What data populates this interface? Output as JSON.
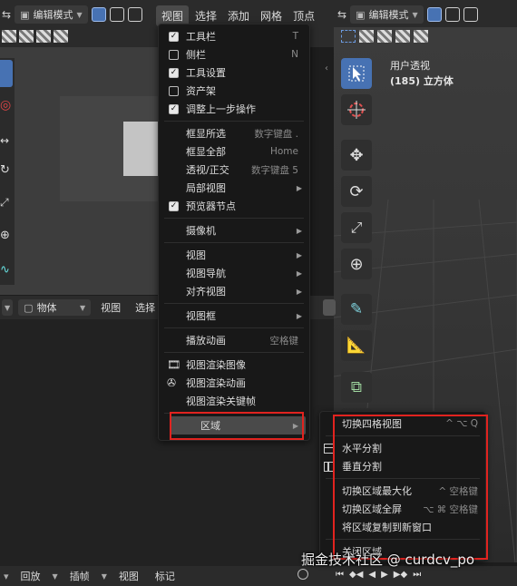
{
  "left_header": {
    "mode": "编辑模式",
    "menus": [
      "视图",
      "选择",
      "添加",
      "网格",
      "顶点"
    ],
    "active_menu": "视图"
  },
  "right_header": {
    "mode": "编辑模式"
  },
  "right_viewport": {
    "view_label": "用户透视",
    "object_label": "(185) 立方体"
  },
  "bottom_left_header": {
    "mode": "物体",
    "menus": [
      "视图",
      "选择"
    ]
  },
  "timeline_header": {
    "menus": [
      "回放",
      "插帧",
      "视图",
      "标记"
    ]
  },
  "view_menu": {
    "items": [
      {
        "label": "工具栏",
        "shortcut": "T",
        "check": "on"
      },
      {
        "label": "侧栏",
        "shortcut": "N",
        "check": "off"
      },
      {
        "label": "工具设置",
        "shortcut": "",
        "check": "on"
      },
      {
        "label": "资产架",
        "shortcut": "",
        "check": "off"
      },
      {
        "label": "调整上一步操作",
        "shortcut": "",
        "check": "on"
      },
      {
        "label": "框显所选",
        "shortcut": "数字键盘 ."
      },
      {
        "label": "框显全部",
        "shortcut": "Home"
      },
      {
        "label": "透视/正交",
        "shortcut": "数字键盘 5"
      },
      {
        "label": "局部视图",
        "submenu": true
      },
      {
        "label": "预览器节点",
        "check": "on"
      },
      {
        "label": "摄像机",
        "submenu": true
      },
      {
        "label": "视图",
        "submenu": true
      },
      {
        "label": "视图导航",
        "submenu": true
      },
      {
        "label": "对齐视图",
        "submenu": true
      },
      {
        "label": "视图框",
        "submenu": true
      },
      {
        "label": "播放动画",
        "shortcut": "空格键"
      },
      {
        "label": "视图渲染图像",
        "icon": "render-image-icon"
      },
      {
        "label": "视图渲染动画",
        "icon": "render-animation-icon"
      },
      {
        "label": "视图渲染关键帧"
      },
      {
        "label": "区域",
        "submenu": true,
        "highlighted": true
      }
    ]
  },
  "area_submenu": {
    "items": [
      {
        "label": "切换四格视图",
        "shortcut": "^ ⌥ Q"
      },
      {
        "label": "水平分割",
        "icon": "split-horizontal-icon"
      },
      {
        "label": "垂直分割",
        "icon": "split-vertical-icon"
      },
      {
        "label": "切换区域最大化",
        "shortcut": "^ 空格键"
      },
      {
        "label": "切换区域全屏",
        "shortcut": "⌥ ⌘ 空格键"
      },
      {
        "label": "将区域复制到新窗口"
      },
      {
        "label": "关闭区域"
      }
    ]
  },
  "watermark": "掘金技术社区 @ curdcv_po",
  "colors": {
    "accent": "#4772b3",
    "highlight_box": "#e1231f",
    "menu_bg": "#181818"
  }
}
